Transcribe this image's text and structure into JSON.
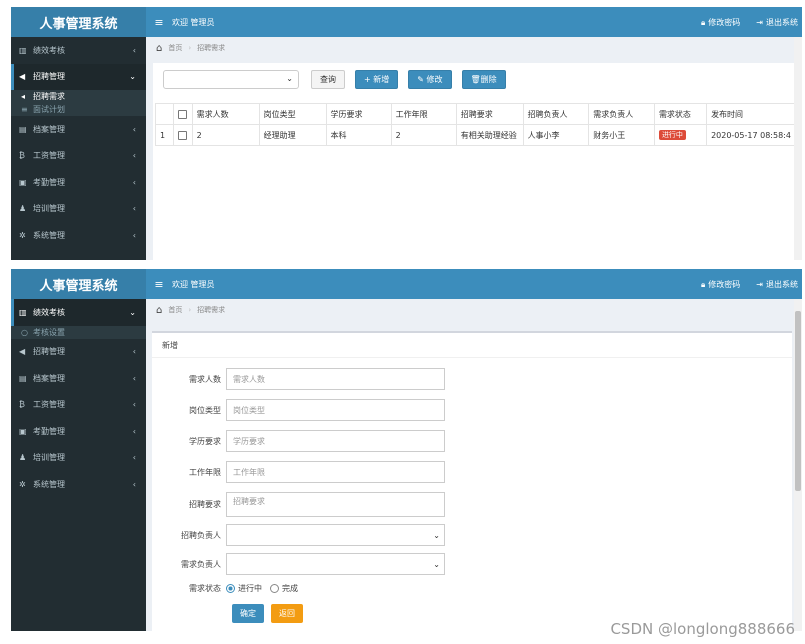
{
  "app": {
    "title": "人事管理系统",
    "welcome": "欢迎 管理员",
    "change_password": "修改密码",
    "logout": "退出系统"
  },
  "screen1": {
    "menu": [
      {
        "label": "绩效考核",
        "icon": "bar-chart-icon"
      },
      {
        "label": "招聘管理",
        "icon": "bullhorn-icon",
        "active": true
      },
      {
        "label": "档案管理",
        "icon": "file-icon"
      },
      {
        "label": "工资管理",
        "icon": "bitcoin-icon"
      },
      {
        "label": "考勤管理",
        "icon": "calendar-check-icon"
      },
      {
        "label": "培训管理",
        "icon": "user-icon"
      },
      {
        "label": "系统管理",
        "icon": "gear-icon"
      }
    ],
    "submenu": [
      {
        "label": "招聘需求",
        "icon": "bullhorn-icon"
      },
      {
        "label": "面试计划",
        "icon": "list-icon"
      }
    ],
    "breadcrumb": {
      "home": "首页",
      "current": "招聘需求"
    },
    "toolbar": {
      "query": "查询",
      "add": "新增",
      "edit": "修改",
      "delete": "删除"
    },
    "table": {
      "headers": [
        "需求人数",
        "岗位类型",
        "学历要求",
        "工作年限",
        "招聘要求",
        "招聘负责人",
        "需求负责人",
        "需求状态",
        "发布时间"
      ],
      "rows": [
        {
          "index": "1",
          "cells": [
            "2",
            "经理助理",
            "本科",
            "2",
            "有相关助理经验",
            "人事小李",
            "财务小王",
            "进行中",
            "2020-05-17 08:58:4"
          ]
        }
      ]
    }
  },
  "screen2": {
    "menu": [
      {
        "label": "绩效考核",
        "icon": "bar-chart-icon",
        "active": true
      },
      {
        "label": "招聘管理",
        "icon": "bullhorn-icon"
      },
      {
        "label": "档案管理",
        "icon": "file-icon"
      },
      {
        "label": "工资管理",
        "icon": "bitcoin-icon"
      },
      {
        "label": "考勤管理",
        "icon": "calendar-check-icon"
      },
      {
        "label": "培训管理",
        "icon": "user-icon"
      },
      {
        "label": "系统管理",
        "icon": "gear-icon"
      }
    ],
    "submenu": [
      {
        "label": "考核设置",
        "icon": "circle-icon"
      }
    ],
    "breadcrumb": {
      "home": "首页",
      "current": "招聘需求"
    },
    "form": {
      "title": "新增",
      "fields": [
        {
          "label": "需求人数",
          "placeholder": "需求人数"
        },
        {
          "label": "岗位类型",
          "placeholder": "岗位类型"
        },
        {
          "label": "学历要求",
          "placeholder": "学历要求"
        },
        {
          "label": "工作年限",
          "placeholder": "工作年限"
        },
        {
          "label": "招聘要求",
          "placeholder": "招聘要求"
        }
      ],
      "recruiter_label": "招聘负责人",
      "demand_owner_label": "需求负责人",
      "status_label": "需求状态",
      "status_options": [
        "进行中",
        "完成"
      ],
      "status_selected": "进行中",
      "ok": "确定",
      "back": "返回"
    }
  },
  "watermark": "CSDN @longlong888666"
}
